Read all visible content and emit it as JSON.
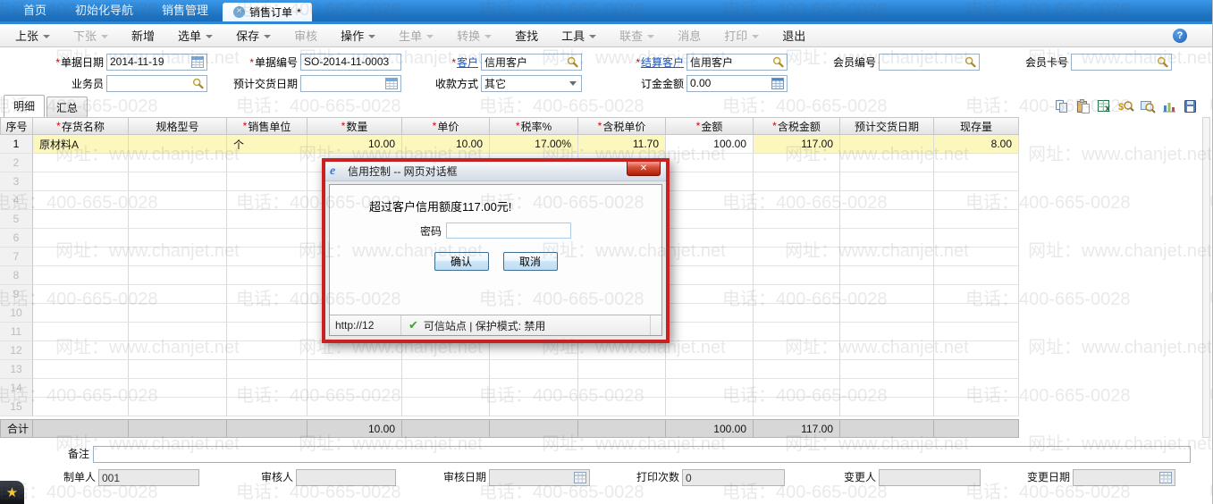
{
  "tabs": {
    "items": [
      {
        "label": "首页"
      },
      {
        "label": "初始化导航"
      },
      {
        "label": "销售管理"
      }
    ],
    "active": {
      "label": "销售订单",
      "modified": "*"
    }
  },
  "toolbar": {
    "items": [
      {
        "label": "上张",
        "arrow": true,
        "disabled": false
      },
      {
        "label": "下张",
        "arrow": true,
        "disabled": true
      },
      {
        "label": "新增",
        "arrow": false,
        "disabled": false
      },
      {
        "label": "选单",
        "arrow": true,
        "disabled": false
      },
      {
        "label": "保存",
        "arrow": true,
        "disabled": false
      },
      {
        "label": "审核",
        "arrow": false,
        "disabled": true
      },
      {
        "label": "操作",
        "arrow": true,
        "disabled": false
      },
      {
        "label": "生单",
        "arrow": true,
        "disabled": true
      },
      {
        "label": "转换",
        "arrow": true,
        "disabled": true
      },
      {
        "label": "查找",
        "arrow": false,
        "disabled": false
      },
      {
        "label": "工具",
        "arrow": true,
        "disabled": false
      },
      {
        "label": "联查",
        "arrow": true,
        "disabled": true
      },
      {
        "label": "消息",
        "arrow": false,
        "disabled": true
      },
      {
        "label": "打印",
        "arrow": true,
        "disabled": true
      },
      {
        "label": "退出",
        "arrow": false,
        "disabled": false
      }
    ]
  },
  "form": {
    "doc_date": {
      "label": "单据日期",
      "value": "2014-11-19"
    },
    "doc_no": {
      "label": "单据编号",
      "value": "SO-2014-11-0003"
    },
    "customer": {
      "label": "客户",
      "value": "信用客户"
    },
    "settle_customer": {
      "label": "结算客户",
      "value": "信用客户"
    },
    "member_no": {
      "label": "会员编号",
      "value": ""
    },
    "member_card": {
      "label": "会员卡号",
      "value": ""
    },
    "salesman": {
      "label": "业务员",
      "value": ""
    },
    "delivery_date": {
      "label": "预计交货日期",
      "value": ""
    },
    "payment_method": {
      "label": "收款方式",
      "value": "其它"
    },
    "deposit": {
      "label": "订金金额",
      "value": "0.00"
    }
  },
  "detail_tabs": {
    "detail": "明细",
    "summary": "汇总"
  },
  "grid": {
    "columns": [
      {
        "label": "序号",
        "required": false
      },
      {
        "label": "存货名称",
        "required": true
      },
      {
        "label": "规格型号",
        "required": false
      },
      {
        "label": "销售单位",
        "required": true
      },
      {
        "label": "数量",
        "required": true
      },
      {
        "label": "单价",
        "required": true
      },
      {
        "label": "税率%",
        "required": true
      },
      {
        "label": "含税单价",
        "required": true
      },
      {
        "label": "金额",
        "required": true
      },
      {
        "label": "含税金额",
        "required": true
      },
      {
        "label": "预计交货日期",
        "required": false
      },
      {
        "label": "现存量",
        "required": false
      }
    ],
    "row_count": 15,
    "rows": [
      {
        "selected": true,
        "cells": [
          "1",
          "原材料A",
          "",
          "个",
          "10.00",
          "10.00",
          "17.00%",
          "11.70",
          "100.00",
          "117.00",
          "",
          "8.00"
        ]
      }
    ],
    "totals": {
      "cells": [
        "合计",
        "",
        "",
        "",
        "10.00",
        "",
        "",
        "",
        "100.00",
        "117.00",
        "",
        ""
      ]
    }
  },
  "dialog": {
    "title": "信用控制 -- 网页对话框",
    "message": "超过客户信用额度117.00元!",
    "password_label": "密码",
    "confirm_label": "确认",
    "cancel_label": "取消",
    "status_url": "http://12",
    "status_text": "可信站点 | 保护模式: 禁用"
  },
  "footer": {
    "note": {
      "label": "备注",
      "value": ""
    },
    "maker": {
      "label": "制单人",
      "value": "001"
    },
    "auditor": {
      "label": "审核人",
      "value": ""
    },
    "audit_date": {
      "label": "审核日期",
      "value": ""
    },
    "print_count": {
      "label": "打印次数",
      "value": "0"
    },
    "changer": {
      "label": "变更人",
      "value": ""
    },
    "change_date": {
      "label": "变更日期",
      "value": ""
    }
  },
  "watermark": {
    "phone": "电话：400-665-0028",
    "url": "网址：www.chanjet.net"
  }
}
